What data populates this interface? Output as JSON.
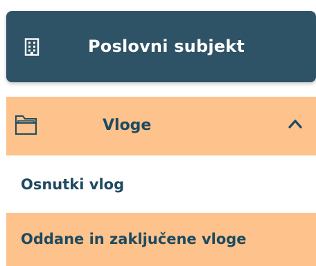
{
  "header": {
    "icon": "building-icon",
    "title": "Poslovni subjekt"
  },
  "menu": {
    "parent": {
      "icon": "folder-icon",
      "label": "Vloge",
      "expanded": true,
      "chevron_icon": "chevron-up-icon"
    },
    "children": [
      {
        "label": "Osnutki vlog",
        "active": false
      },
      {
        "label": "Oddane in zaključene vloge",
        "active": true
      }
    ]
  },
  "colors": {
    "header_bg": "#2f5366",
    "header_text": "#ffffff",
    "highlight_bg": "#fec28c",
    "menu_text": "#1d4a5f"
  }
}
